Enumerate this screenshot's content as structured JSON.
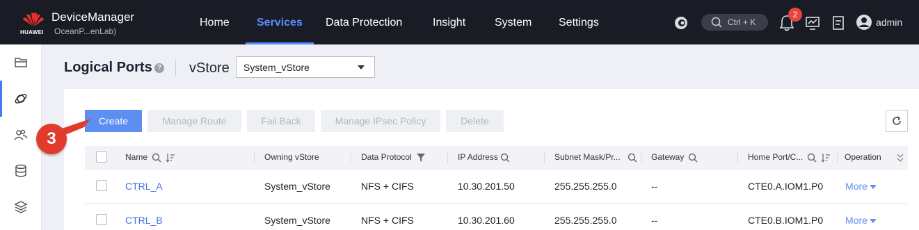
{
  "topbar": {
    "brand": "HUAWEI",
    "app_title": "DeviceManager",
    "app_subtitle": "OceanP...enLab)",
    "nav": [
      "Home",
      "Services",
      "Data Protection",
      "Insight",
      "System",
      "Settings"
    ],
    "active_nav": "Services",
    "search_shortcut": "Ctrl + K",
    "notification_count": "2",
    "user": "admin"
  },
  "page": {
    "title": "Logical Ports",
    "vstore_label": "vStore",
    "vstore_selected": "System_vStore"
  },
  "toolbar": {
    "create": "Create",
    "manage_route": "Manage Route",
    "fail_back": "Fail Back",
    "manage_ipsec": "Manage IPsec Policy",
    "delete": "Delete"
  },
  "annotation": "3",
  "table": {
    "columns": [
      "Name",
      "Owning vStore",
      "Data Protocol",
      "IP Address",
      "Subnet Mask/Pr...",
      "Gateway",
      "Home Port/C...",
      "Operation"
    ],
    "rows": [
      {
        "name": "CTRL_A",
        "vstore": "System_vStore",
        "protocol": "NFS + CIFS",
        "ip": "10.30.201.50",
        "mask": "255.255.255.0",
        "gateway": "--",
        "port": "CTE0.A.IOM1.P0",
        "op": "More"
      },
      {
        "name": "CTRL_B",
        "vstore": "System_vStore",
        "protocol": "NFS + CIFS",
        "ip": "10.30.201.60",
        "mask": "255.255.255.0",
        "gateway": "--",
        "port": "CTE0.B.IOM1.P0",
        "op": "More"
      }
    ]
  },
  "colors": {
    "topbar_bg": "#191c24",
    "accent": "#5d8ef2",
    "active_nav": "#5b8cff",
    "annotation": "#e23b2e"
  }
}
